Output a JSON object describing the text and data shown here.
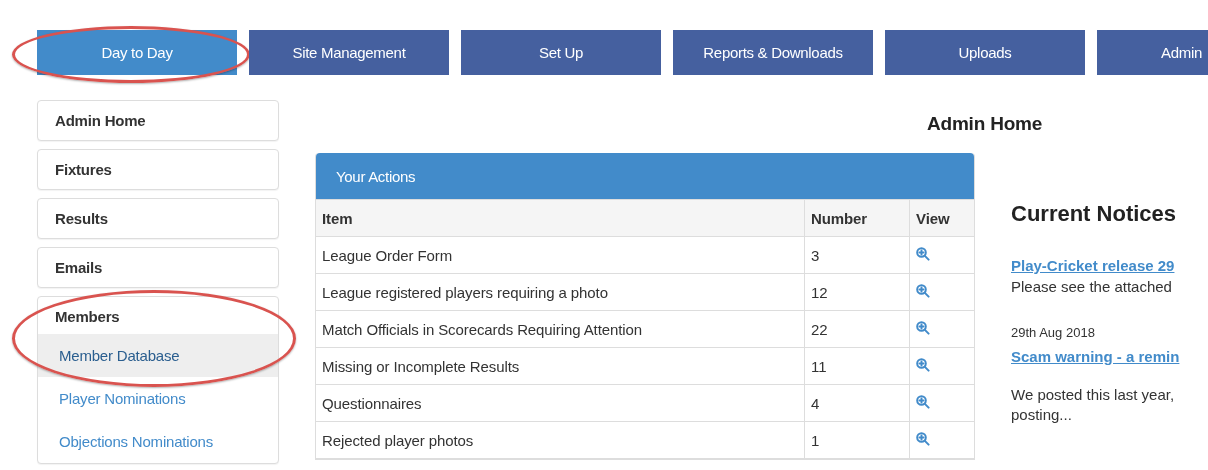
{
  "tabs": [
    {
      "label": "Day to Day",
      "selected": true,
      "circled": true
    },
    {
      "label": "Site Management",
      "selected": false,
      "circled": false
    },
    {
      "label": "Set Up",
      "selected": false,
      "circled": false
    },
    {
      "label": "Reports & Downloads",
      "selected": false,
      "circled": false
    },
    {
      "label": "Uploads",
      "selected": false,
      "circled": false
    },
    {
      "label": "Admin",
      "selected": false,
      "circled": false
    }
  ],
  "sidebar": {
    "items": [
      {
        "label": "Admin Home"
      },
      {
        "label": "Fixtures"
      },
      {
        "label": "Results"
      },
      {
        "label": "Emails"
      },
      {
        "label": "Members",
        "children": [
          {
            "label": "Member Database",
            "selected": true,
            "circled": true
          },
          {
            "label": "Player Nominations",
            "selected": false,
            "circled": false
          },
          {
            "label": "Objections Nominations",
            "selected": false,
            "circled": false
          }
        ]
      }
    ]
  },
  "page_title": "Admin Home",
  "actions": {
    "title": "Your Actions",
    "columns": [
      "Item",
      "Number",
      "View"
    ],
    "rows": [
      {
        "item": "League Order Form",
        "number": "3"
      },
      {
        "item": "League registered players requiring a photo",
        "number": "12"
      },
      {
        "item": "Match Officials in Scorecards Requiring Attention",
        "number": "22"
      },
      {
        "item": "Missing or Incomplete Results",
        "number": "11"
      },
      {
        "item": "Questionnaires",
        "number": "4"
      },
      {
        "item": "Rejected player photos",
        "number": "1"
      }
    ]
  },
  "notices": {
    "heading": "Current Notices",
    "items": [
      {
        "title": "Play-Cricket release 29",
        "summary": "Please see the attached"
      },
      {
        "date": "29th Aug 2018",
        "title": "Scam warning - a remin",
        "summary": "We posted this last year,",
        "summary_2": "posting..."
      }
    ]
  }
}
